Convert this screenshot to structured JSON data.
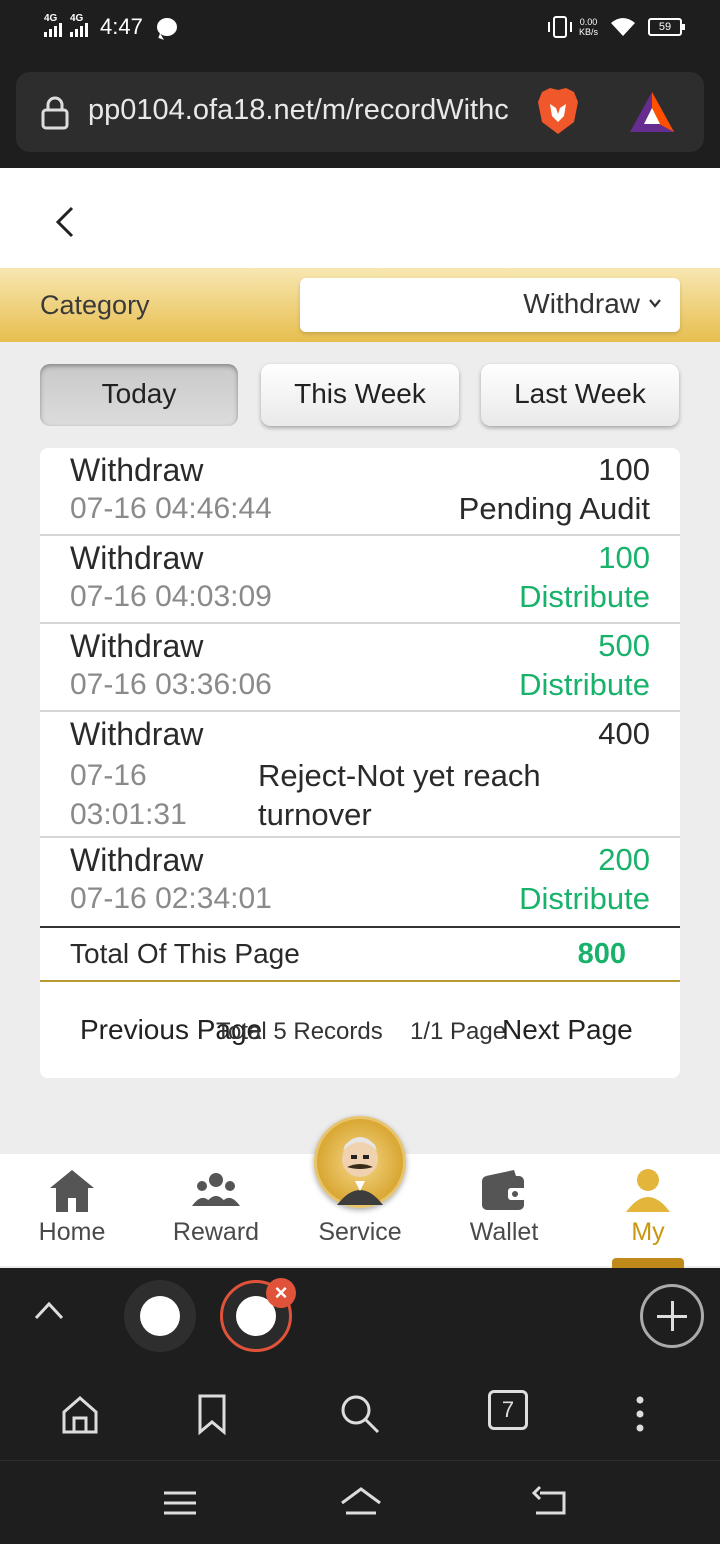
{
  "status_bar": {
    "network1": "4G",
    "network2": "4G",
    "time": "4:47",
    "speed_value": "0.00",
    "speed_unit": "KB/s",
    "battery": "59"
  },
  "browser": {
    "url": "pp0104.ofa18.net/m/recordWithc"
  },
  "category": {
    "label": "Category",
    "selected": "Withdraw"
  },
  "tabs": [
    {
      "label": "Today",
      "active": true
    },
    {
      "label": "This Week",
      "active": false
    },
    {
      "label": "Last Week",
      "active": false
    }
  ],
  "records": [
    {
      "type": "Withdraw",
      "time": "07-16 04:46:44",
      "amount": "100",
      "status": "Pending Audit"
    },
    {
      "type": "Withdraw",
      "time": "07-16 04:03:09",
      "amount": "100",
      "status": "Distribute"
    },
    {
      "type": "Withdraw",
      "time": "07-16 03:36:06",
      "amount": "500",
      "status": "Distribute"
    },
    {
      "type": "Withdraw",
      "time_date": "07-16",
      "time_clock": "03:01:31",
      "amount": "400",
      "status_line1": "Reject-Not yet reach",
      "status_line2": "turnover"
    },
    {
      "type": "Withdraw",
      "time": "07-16 02:34:01",
      "amount": "200",
      "status": "Distribute"
    }
  ],
  "total": {
    "label": "Total Of This Page",
    "value": "800"
  },
  "pagination": {
    "previous": "Previous Page",
    "total_records": "Total 5 Records",
    "page": "1/1 Page",
    "next": "Next Page"
  },
  "bottom_nav": [
    {
      "label": "Home",
      "icon": "home-icon"
    },
    {
      "label": "Reward",
      "icon": "group-icon"
    },
    {
      "label": "Service",
      "icon": "service-avatar"
    },
    {
      "label": "Wallet",
      "icon": "wallet-icon"
    },
    {
      "label": "My",
      "icon": "user-icon"
    }
  ],
  "browser_toolbar": {
    "tab_count": "7"
  },
  "colors": {
    "accent_gold": "#c8960f",
    "success_green": "#19b26b",
    "reject_red": "#e0533a"
  }
}
